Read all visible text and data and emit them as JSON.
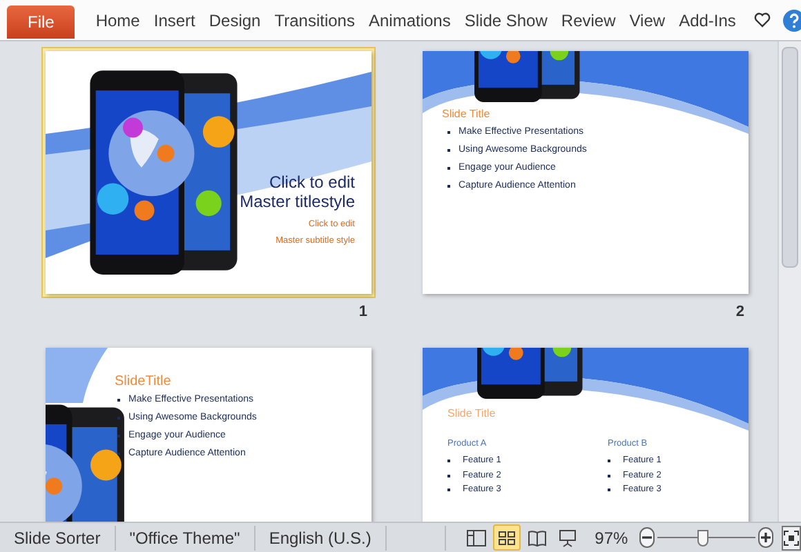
{
  "ribbon": {
    "file_tab": "File",
    "tabs": [
      {
        "label": "Home",
        "selected": false
      },
      {
        "label": "Insert",
        "selected": false
      },
      {
        "label": "Design",
        "selected": false
      },
      {
        "label": "Transitions",
        "selected": false
      },
      {
        "label": "Animations",
        "selected": false
      },
      {
        "label": "Slide Show",
        "selected": false
      },
      {
        "label": "Review",
        "selected": false
      },
      {
        "label": "View",
        "selected": false
      },
      {
        "label": "Add-Ins",
        "selected": false
      }
    ]
  },
  "slides": [
    {
      "kind": "title",
      "number": "1",
      "selected": true,
      "title": [
        "Click to edit",
        "Master titlestyle"
      ],
      "subtitle": [
        "Click to edit",
        "Master subtitle style"
      ]
    },
    {
      "kind": "bullets",
      "number": "2",
      "selected": false,
      "title": "Slide Title",
      "bullets": [
        "Make Effective Presentations",
        "Using Awesome Backgrounds",
        "Engage your Audience",
        "Capture Audience Attention"
      ]
    },
    {
      "kind": "side-bullets",
      "selected": false,
      "title": "SlideTitle",
      "bullets": [
        "Make Effective Presentations",
        "Using Awesome Backgrounds",
        "Engage your Audience",
        "Capture Audience Attention"
      ]
    },
    {
      "kind": "two-column",
      "selected": false,
      "title": "Slide Title",
      "columns": [
        {
          "heading": "Product A",
          "items": [
            "Feature 1",
            "Feature 2",
            "Feature 3"
          ]
        },
        {
          "heading": "Product B",
          "items": [
            "Feature 1",
            "Feature 2",
            "Feature 3"
          ]
        }
      ]
    }
  ],
  "status_bar": {
    "items": [
      "Slide Sorter",
      "\"Office Theme\"",
      "English (U.S.)"
    ],
    "views": [
      {
        "kind": "normal",
        "selected": false
      },
      {
        "kind": "sorter",
        "selected": true
      },
      {
        "kind": "reading",
        "selected": false
      },
      {
        "kind": "slideshow",
        "selected": false
      }
    ],
    "zoom": "97%",
    "zoom_slider": {
      "level": 0.47
    }
  }
}
